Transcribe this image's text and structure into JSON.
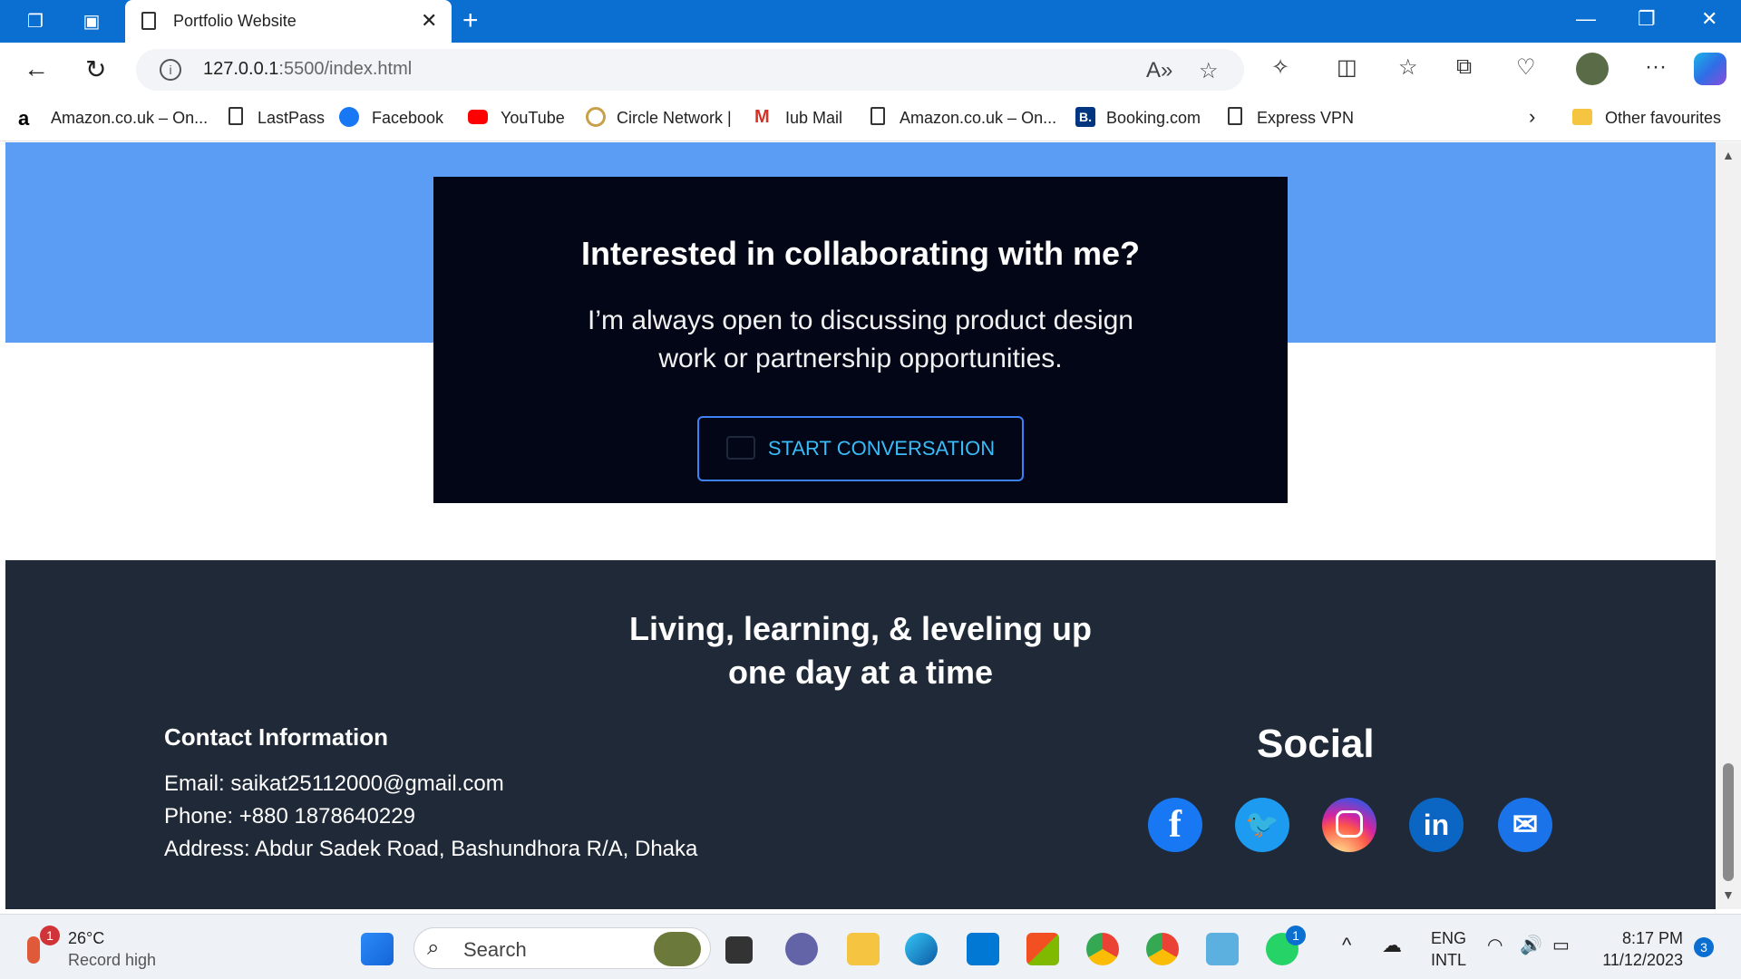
{
  "browser": {
    "tab_title": "Portfolio Website",
    "url_host": "127.0.0.1",
    "url_path": ":5500/index.html",
    "bookmarks": [
      {
        "label": "Amazon.co.uk – On...",
        "icon": "amazon-icon"
      },
      {
        "label": "LastPass",
        "icon": "page-icon"
      },
      {
        "label": "Facebook",
        "icon": "facebook-icon"
      },
      {
        "label": "YouTube",
        "icon": "youtube-icon"
      },
      {
        "label": "Circle Network |",
        "icon": "circle-network-icon"
      },
      {
        "label": "Iub Mail",
        "icon": "gmail-icon"
      },
      {
        "label": "Amazon.co.uk – On...",
        "icon": "page-icon"
      },
      {
        "label": "Booking.com",
        "icon": "booking-icon"
      },
      {
        "label": "Express VPN",
        "icon": "page-icon"
      }
    ],
    "other_favourites": "Other favourites"
  },
  "cta": {
    "heading": "Interested in collaborating with me?",
    "text": "I’m always open to discussing product design work or partnership opportunities.",
    "button_label": "START CONVERSATION"
  },
  "footer": {
    "tagline_line1": "Living, learning, & leveling up",
    "tagline_line2": "one day at a time",
    "contact_heading": "Contact Information",
    "email": "Email: saikat25112000@gmail.com",
    "phone": "Phone: +880 1878640229",
    "address": "Address: Abdur Sadek Road, Bashundhora R/A, Dhaka",
    "social_heading": "Social",
    "social_icons": [
      "facebook-icon",
      "twitter-icon",
      "instagram-icon",
      "linkedin-icon",
      "email-icon"
    ]
  },
  "taskbar": {
    "weather_temp": "26°C",
    "weather_desc": "Record high",
    "weather_badge": "1",
    "search_label": "Search",
    "whatsapp_badge": "1",
    "lang_top": "ENG",
    "lang_bottom": "INTL",
    "time": "8:17 PM",
    "date": "11/12/2023",
    "notification_count": "3"
  },
  "colors": {
    "tabbar": "#0a6fd1",
    "hero_blue": "#5b9cf5",
    "cta_bg": "#020617",
    "footer_bg": "#1f2937",
    "cta_button": "#38bdf8"
  }
}
